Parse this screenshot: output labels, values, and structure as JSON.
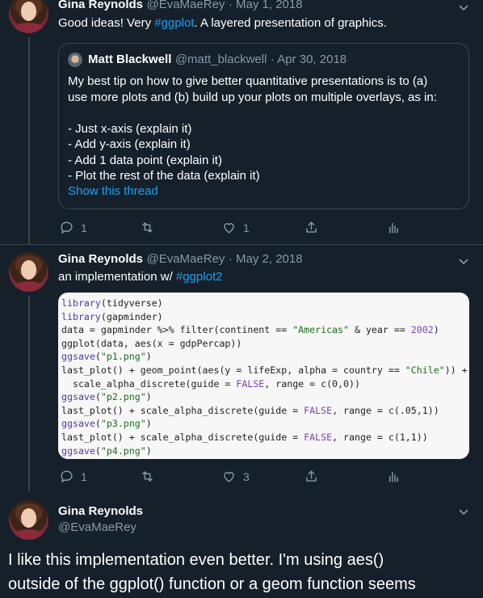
{
  "tweets": [
    {
      "name": "Gina Reynolds",
      "handle": "@EvaMaeRey",
      "date": "· May 1, 2018",
      "text_pre": "Good ideas!  Very ",
      "hashtag": "#ggplot",
      "text_post": ".  A layered presentation of graphics.",
      "quote": {
        "name": "Matt Blackwell",
        "handle": "@matt_blackwell",
        "date": "· Apr 30, 2018",
        "lines": [
          "My best tip on how to give better quantitative presentations is to (a)",
          "use more plots and (b) build up your plots on multiple overlays, as in:",
          "",
          "- Just x-axis (explain it)",
          "- Add y-axis (explain it)",
          "- Add 1 data point (explain it)",
          "- Plot the rest of the data (explain it)"
        ],
        "show_thread": "Show this thread"
      },
      "reply_count": "1",
      "like_count": "1"
    },
    {
      "name": "Gina Reynolds",
      "handle": "@EvaMaeRey",
      "date": "· May 2, 2018",
      "text_pre": "an implementation w/ ",
      "hashtag": "#ggplot2",
      "code_lines": [
        "library(tidyverse)",
        "library(gapminder)",
        "data = gapminder %>% filter(continent == \"Americas\" & year == 2002)",
        "ggplot(data, aes(x = gdpPercap))",
        "ggsave(\"p1.png\")",
        "last_plot() + geom_point(aes(y = lifeExp, alpha = country == \"Chile\")) +",
        "  scale_alpha_discrete(guide = FALSE, range = c(0,0))",
        "ggsave(\"p2.png\")",
        "last_plot() + scale_alpha_discrete(guide = FALSE, range = c(.05,1))",
        "ggsave(\"p3.png\")",
        "last_plot() + scale_alpha_discrete(guide = FALSE, range = c(1,1))",
        "ggsave(\"p4.png\")"
      ],
      "reply_count": "1",
      "like_count": "3"
    },
    {
      "name": "Gina Reynolds",
      "handle": "@EvaMaeRey",
      "text_line1": "I like this implementation even better.  I'm using aes()",
      "text_line2": "outside of the ggplot() function or a geom function seems"
    }
  ],
  "colors": {
    "background": "#15202b",
    "accent": "#1da1f2",
    "muted": "#8899a6",
    "border": "#38444d"
  }
}
